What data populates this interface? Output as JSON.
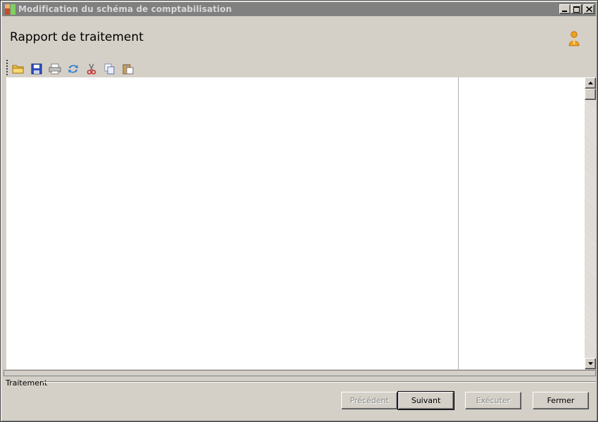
{
  "window": {
    "title": "Modification du schéma de comptabilisation"
  },
  "header": {
    "title": "Rapport de traitement"
  },
  "toolbar": {
    "items": [
      {
        "icon": "open-folder-icon"
      },
      {
        "icon": "save-icon"
      },
      {
        "icon": "print-icon"
      },
      {
        "icon": "refresh-icon"
      },
      {
        "icon": "cut-icon"
      },
      {
        "icon": "copy-icon"
      },
      {
        "icon": "paste-icon"
      }
    ]
  },
  "status": {
    "group_label": "Traitement"
  },
  "buttons": {
    "previous": "Précédent",
    "next": "Suivant",
    "execute": "Exécuter",
    "close": "Fermer"
  },
  "colors": {
    "titlebar": "#808080",
    "face": "#d4d0c8",
    "folder": "#f0c040",
    "save": "#3050c0",
    "refresh": "#2a7ad0",
    "cut": "#c83030",
    "user": "#f0a020"
  }
}
